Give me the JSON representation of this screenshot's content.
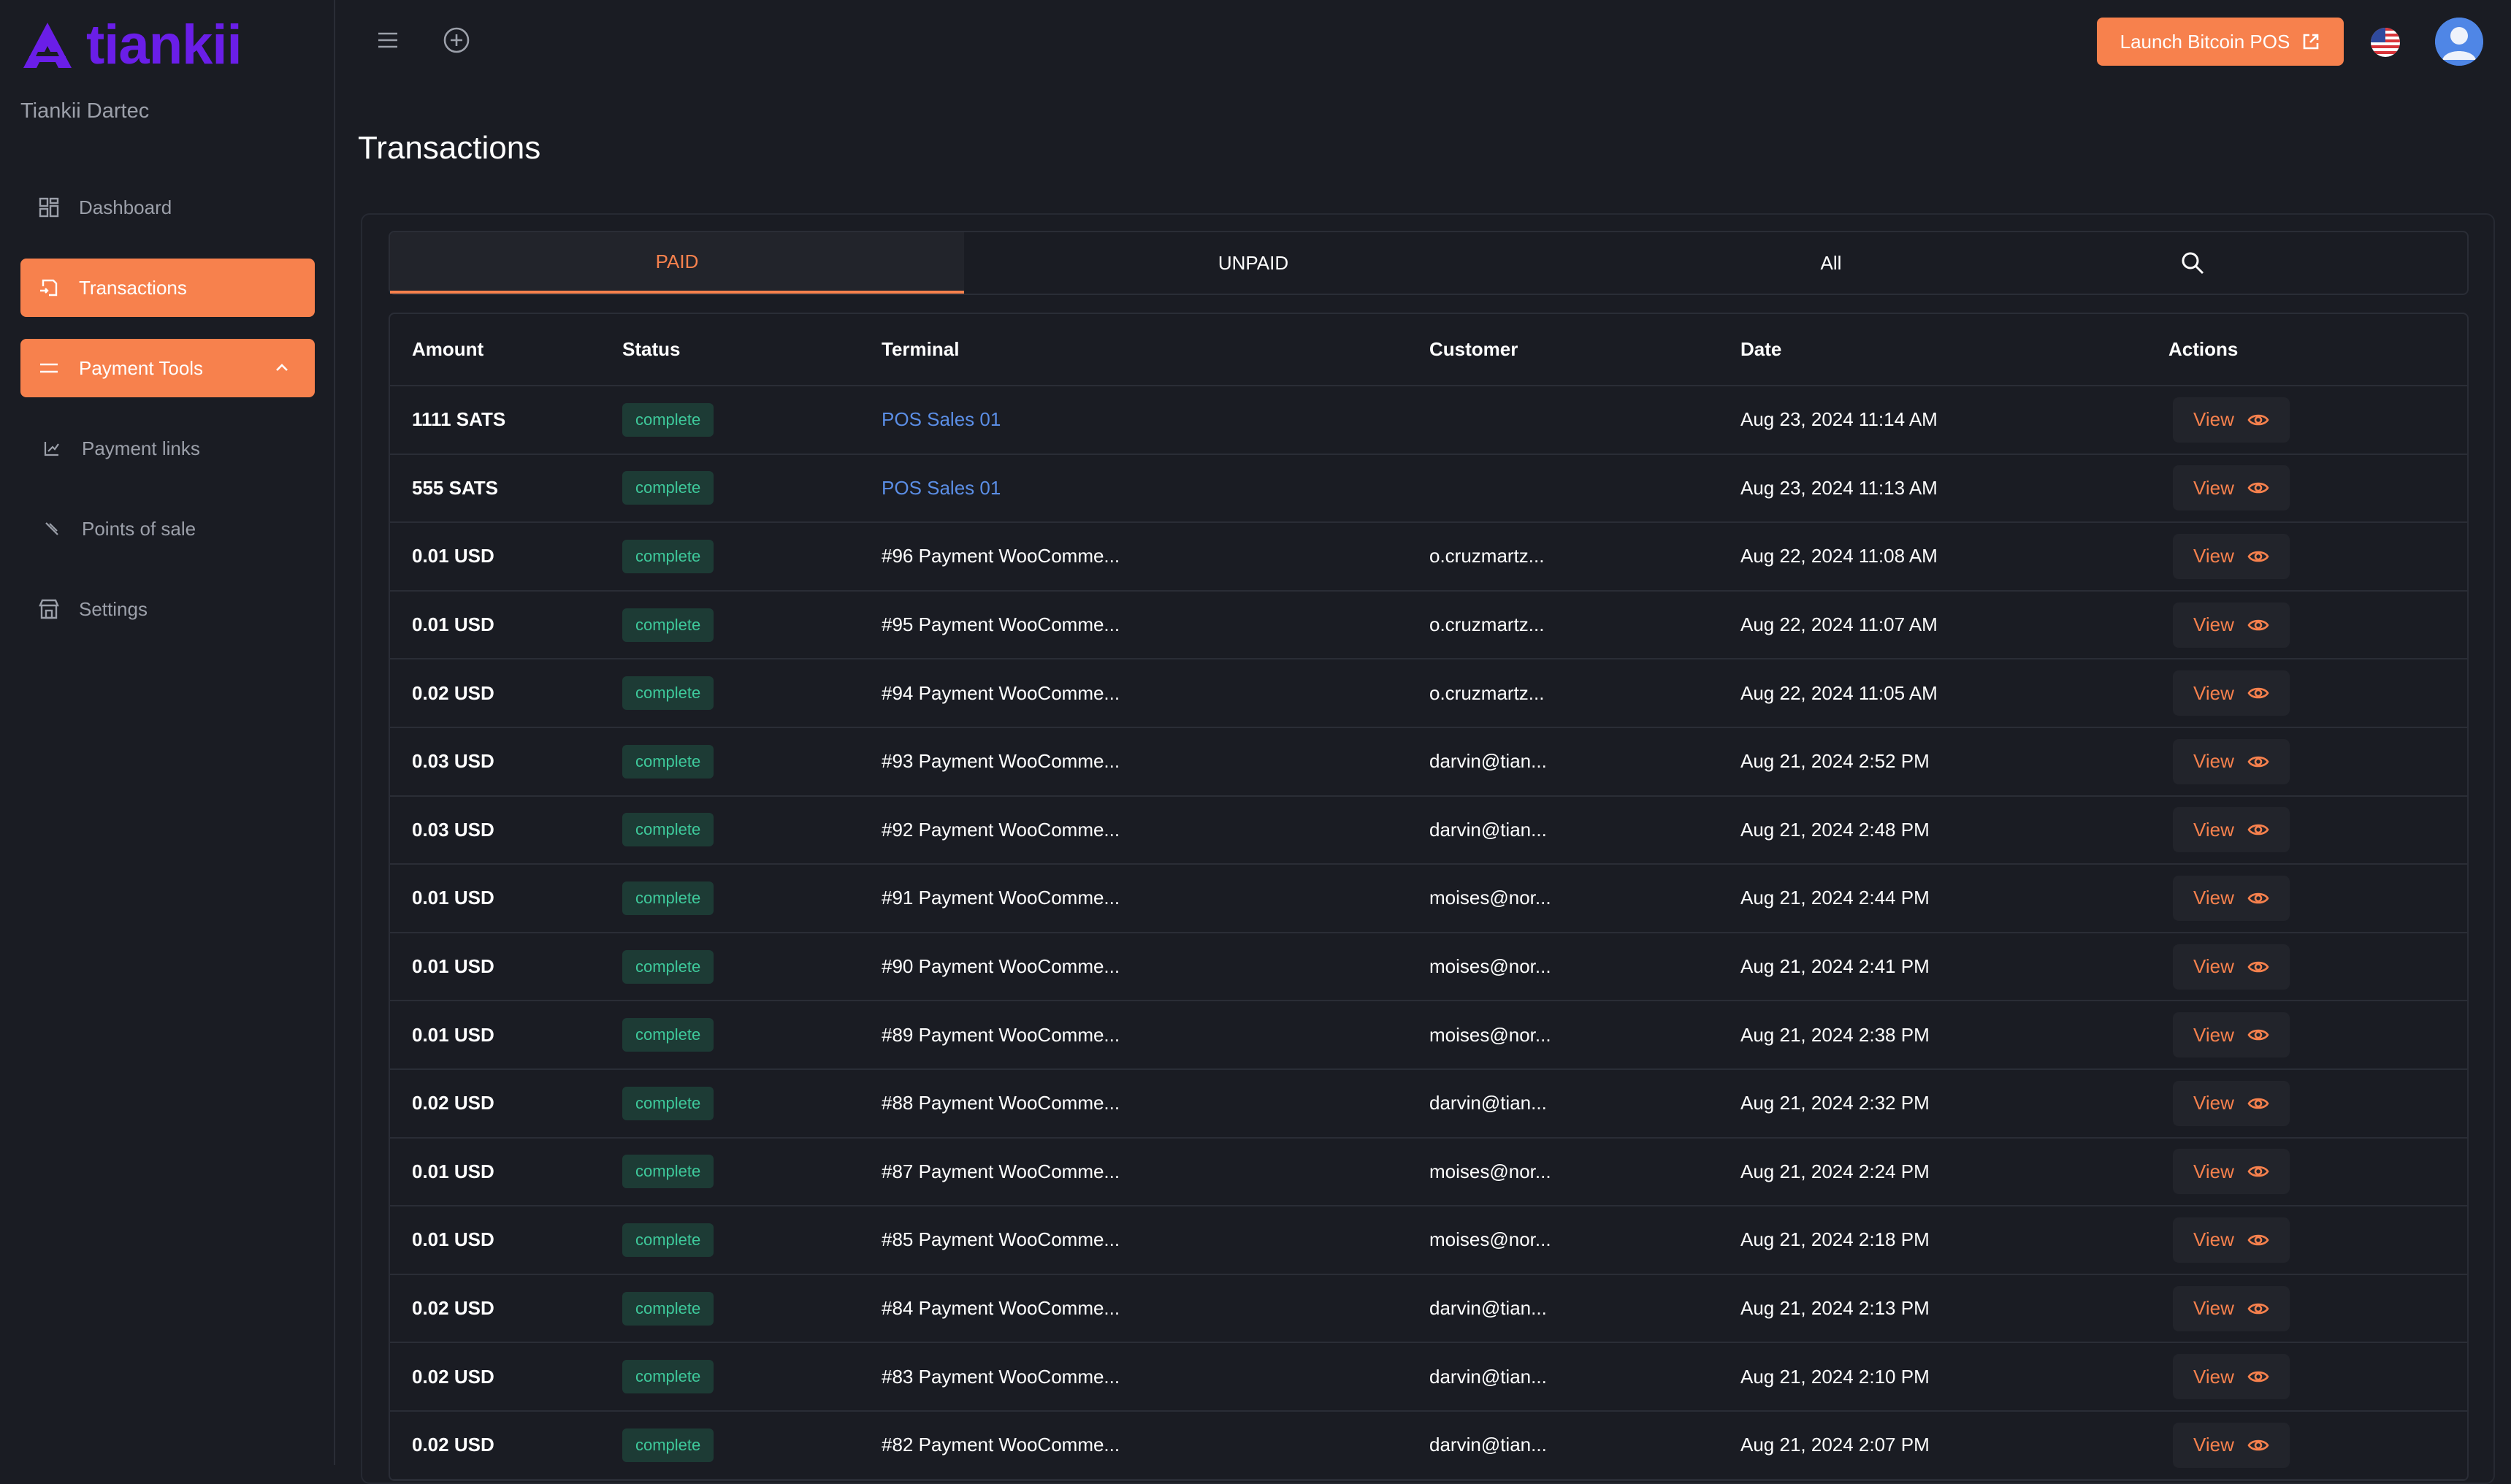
{
  "brand": {
    "name": "tiankii",
    "color": "#6a1ee8"
  },
  "org_name": "Tiankii Dartec",
  "sidebar": {
    "items": [
      {
        "label": "Dashboard",
        "icon": "grid-icon",
        "active": false
      },
      {
        "label": "Transactions",
        "icon": "transfer-icon",
        "active": true
      },
      {
        "label": "Payment Tools",
        "icon": "tools-icon",
        "active": true,
        "expanded": true
      },
      {
        "label": "Payment links",
        "icon": "link-icon",
        "active": false
      },
      {
        "label": "Points of sale",
        "icon": "pos-icon",
        "active": false
      },
      {
        "label": "Settings",
        "icon": "store-icon",
        "active": false
      }
    ]
  },
  "topbar": {
    "launch_label": "Launch Bitcoin POS",
    "language_icon": "us-flag-icon",
    "accent": "#f7814d"
  },
  "page": {
    "title": "Transactions"
  },
  "tabs": [
    "PAID",
    "UNPAID",
    "All"
  ],
  "table": {
    "columns": [
      "Amount",
      "Status",
      "Terminal",
      "Customer",
      "Date",
      "Actions"
    ],
    "action_label": "View",
    "rows": [
      {
        "amount": "1111 SATS",
        "status": "complete",
        "terminal": "POS Sales 01",
        "terminal_link": true,
        "customer": "",
        "date": "Aug 23, 2024 11:14 AM"
      },
      {
        "amount": "555 SATS",
        "status": "complete",
        "terminal": "POS Sales 01",
        "terminal_link": true,
        "customer": "",
        "date": "Aug 23, 2024 11:13 AM"
      },
      {
        "amount": "0.01 USD",
        "status": "complete",
        "terminal": "#96 Payment WooComme...",
        "terminal_link": false,
        "customer": "o.cruzmartz...",
        "date": "Aug 22, 2024 11:08 AM"
      },
      {
        "amount": "0.01 USD",
        "status": "complete",
        "terminal": "#95 Payment WooComme...",
        "terminal_link": false,
        "customer": "o.cruzmartz...",
        "date": "Aug 22, 2024 11:07 AM"
      },
      {
        "amount": "0.02 USD",
        "status": "complete",
        "terminal": "#94 Payment WooComme...",
        "terminal_link": false,
        "customer": "o.cruzmartz...",
        "date": "Aug 22, 2024 11:05 AM"
      },
      {
        "amount": "0.03 USD",
        "status": "complete",
        "terminal": "#93 Payment WooComme...",
        "terminal_link": false,
        "customer": "darvin@tian...",
        "date": "Aug 21, 2024 2:52 PM"
      },
      {
        "amount": "0.03 USD",
        "status": "complete",
        "terminal": "#92 Payment WooComme...",
        "terminal_link": false,
        "customer": "darvin@tian...",
        "date": "Aug 21, 2024 2:48 PM"
      },
      {
        "amount": "0.01 USD",
        "status": "complete",
        "terminal": "#91 Payment WooComme...",
        "terminal_link": false,
        "customer": "moises@nor...",
        "date": "Aug 21, 2024 2:44 PM"
      },
      {
        "amount": "0.01 USD",
        "status": "complete",
        "terminal": "#90 Payment WooComme...",
        "terminal_link": false,
        "customer": "moises@nor...",
        "date": "Aug 21, 2024 2:41 PM"
      },
      {
        "amount": "0.01 USD",
        "status": "complete",
        "terminal": "#89 Payment WooComme...",
        "terminal_link": false,
        "customer": "moises@nor...",
        "date": "Aug 21, 2024 2:38 PM"
      },
      {
        "amount": "0.02 USD",
        "status": "complete",
        "terminal": "#88 Payment WooComme...",
        "terminal_link": false,
        "customer": "darvin@tian...",
        "date": "Aug 21, 2024 2:32 PM"
      },
      {
        "amount": "0.01 USD",
        "status": "complete",
        "terminal": "#87 Payment WooComme...",
        "terminal_link": false,
        "customer": "moises@nor...",
        "date": "Aug 21, 2024 2:24 PM"
      },
      {
        "amount": "0.01 USD",
        "status": "complete",
        "terminal": "#85 Payment WooComme...",
        "terminal_link": false,
        "customer": "moises@nor...",
        "date": "Aug 21, 2024 2:18 PM"
      },
      {
        "amount": "0.02 USD",
        "status": "complete",
        "terminal": "#84 Payment WooComme...",
        "terminal_link": false,
        "customer": "darvin@tian...",
        "date": "Aug 21, 2024 2:13 PM"
      },
      {
        "amount": "0.02 USD",
        "status": "complete",
        "terminal": "#83 Payment WooComme...",
        "terminal_link": false,
        "customer": "darvin@tian...",
        "date": "Aug 21, 2024 2:10 PM"
      },
      {
        "amount": "0.02 USD",
        "status": "complete",
        "terminal": "#82 Payment WooComme...",
        "terminal_link": false,
        "customer": "darvin@tian...",
        "date": "Aug 21, 2024 2:07 PM"
      }
    ]
  }
}
